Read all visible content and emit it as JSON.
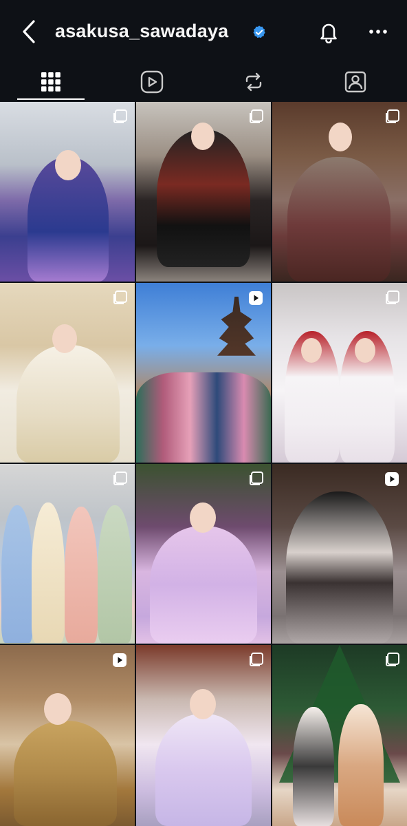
{
  "header": {
    "username": "asakusa_sawadaya",
    "verified": true,
    "back_icon": "chevron-left-icon",
    "bell_icon": "bell-icon",
    "more_icon": "more-horizontal-icon"
  },
  "tabs": [
    {
      "icon": "grid-icon",
      "active": true
    },
    {
      "icon": "reels-icon",
      "active": false
    },
    {
      "icon": "reposts-icon",
      "active": false
    },
    {
      "icon": "tagged-icon",
      "active": false
    }
  ],
  "grid": {
    "posts": [
      {
        "type": "carousel",
        "subject": "kimono-snow-umbrella"
      },
      {
        "type": "carousel",
        "subject": "black-red-lolita-kimono"
      },
      {
        "type": "carousel",
        "subject": "plaid-hakama"
      },
      {
        "type": "carousel",
        "subject": "white-furisode"
      },
      {
        "type": "reel",
        "subject": "pagoda-group"
      },
      {
        "type": "carousel",
        "subject": "red-bonnet-duo"
      },
      {
        "type": "carousel",
        "subject": "four-pastel-kimono"
      },
      {
        "type": "carousel",
        "subject": "pastel-bonnet-kimono"
      },
      {
        "type": "reel",
        "subject": "black-bow-back"
      },
      {
        "type": "reel",
        "subject": "gold-kimono-selfie"
      },
      {
        "type": "carousel",
        "subject": "lavender-kimono-temple"
      },
      {
        "type": "carousel",
        "subject": "christmas-tree-duo"
      }
    ]
  },
  "colors": {
    "background": "#0e1116",
    "text": "#ffffff",
    "verified_badge": "#3897f0"
  }
}
